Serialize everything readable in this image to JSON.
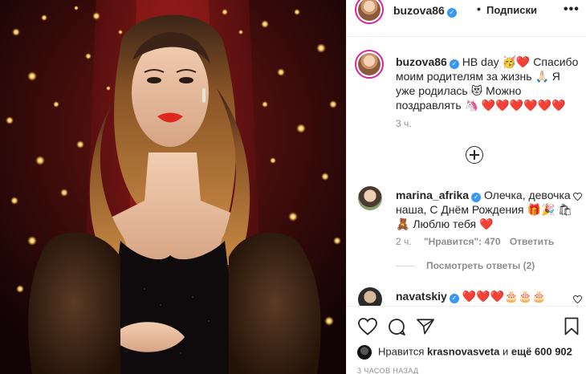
{
  "post": {
    "author": {
      "username": "buzova86",
      "follow_label": "Подписки",
      "more_label": "•••"
    },
    "caption": {
      "username": "buzova86",
      "text": "HB day 🥳❤️ Спасибо моим родителям за жизнь 🙏🏻 Я уже родилась 😻 Можно поздравлять 🦄 ❤️❤️❤️❤️❤️❤️",
      "time": "3 ч."
    },
    "comments": [
      {
        "username": "marina_afrika",
        "text": "Олечка, девочка наша, С Днём Рождения 🎁🎉 🛍🧸 Люблю тебя ❤️",
        "time": "2 ч.",
        "likes": "\"Нравится\": 470",
        "reply_label": "Ответить",
        "view_replies": "Посмотреть ответы (2)"
      },
      {
        "username": "navatskiy",
        "text": "❤️❤️❤️🎂🎂🎂"
      }
    ],
    "likes": {
      "prefix": "Нравится",
      "user": "krasnovasveta",
      "middle": "и",
      "rest": "ещё 600 902"
    },
    "posted_ago": "3 ЧАСОВ НАЗАД",
    "colors": {
      "verified": "#3897f0",
      "story_ring": "#d6249f",
      "secondary_text": "#8e8e8e",
      "heart": "#ed4956"
    }
  }
}
